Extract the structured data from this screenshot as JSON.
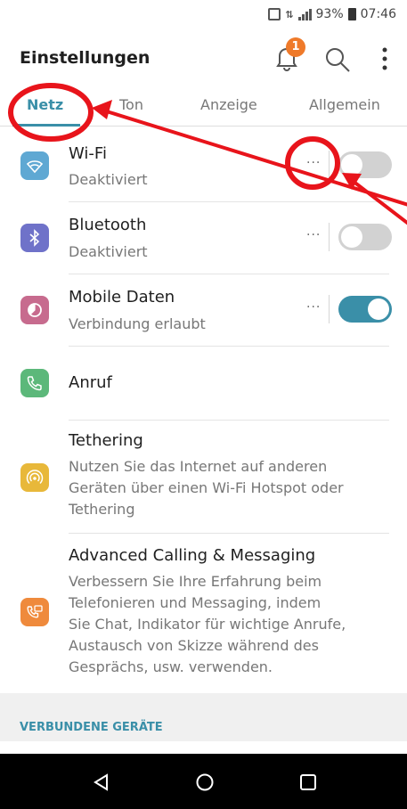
{
  "status_bar": {
    "battery": "93%",
    "time": "07:46"
  },
  "header": {
    "title": "Einstellungen",
    "notification_count": "1"
  },
  "tabs": [
    {
      "label": "Netz",
      "active": true
    },
    {
      "label": "Ton",
      "active": false
    },
    {
      "label": "Anzeige",
      "active": false
    },
    {
      "label": "Allgemein",
      "active": false
    }
  ],
  "items": {
    "wifi": {
      "title": "Wi-Fi",
      "subtitle": "Deaktiviert",
      "more": "···",
      "enabled": false,
      "icon": "wifi-icon",
      "color": "#5fa8d3"
    },
    "bluetooth": {
      "title": "Bluetooth",
      "subtitle": "Deaktiviert",
      "more": "···",
      "enabled": false,
      "icon": "bluetooth-icon",
      "color": "#6f72c9"
    },
    "mobile_data": {
      "title": "Mobile Daten",
      "subtitle": "Verbindung erlaubt",
      "more": "···",
      "enabled": true,
      "icon": "mobile-data-icon",
      "color": "#c76b8e"
    },
    "call": {
      "title": "Anruf",
      "icon": "phone-icon",
      "color": "#5cb87a"
    },
    "tethering": {
      "title": "Tethering",
      "subtitle_lines": [
        "Nutzen Sie das Internet auf anderen",
        "Geräten über einen Wi-Fi Hotspot oder",
        "Tethering"
      ],
      "icon": "hotspot-icon",
      "color": "#e8b83a"
    },
    "advanced_calling": {
      "title": "Advanced Calling & Messaging",
      "subtitle_lines": [
        "Verbessern Sie Ihre Erfahrung beim",
        "Telefonieren und Messaging, indem",
        "Sie Chat, Indikator für wichtige Anrufe,",
        "Austausch von Skizze während des",
        "Gesprächs, usw. verwenden."
      ],
      "icon": "advanced-calling-icon",
      "color": "#ef8a3c"
    }
  },
  "section": {
    "connected_devices": "VERBUNDENE GERÄTE"
  },
  "colors": {
    "accent": "#3a8fa8",
    "annotation": "#e8141b",
    "toggle_off": "#d2d2d2"
  }
}
